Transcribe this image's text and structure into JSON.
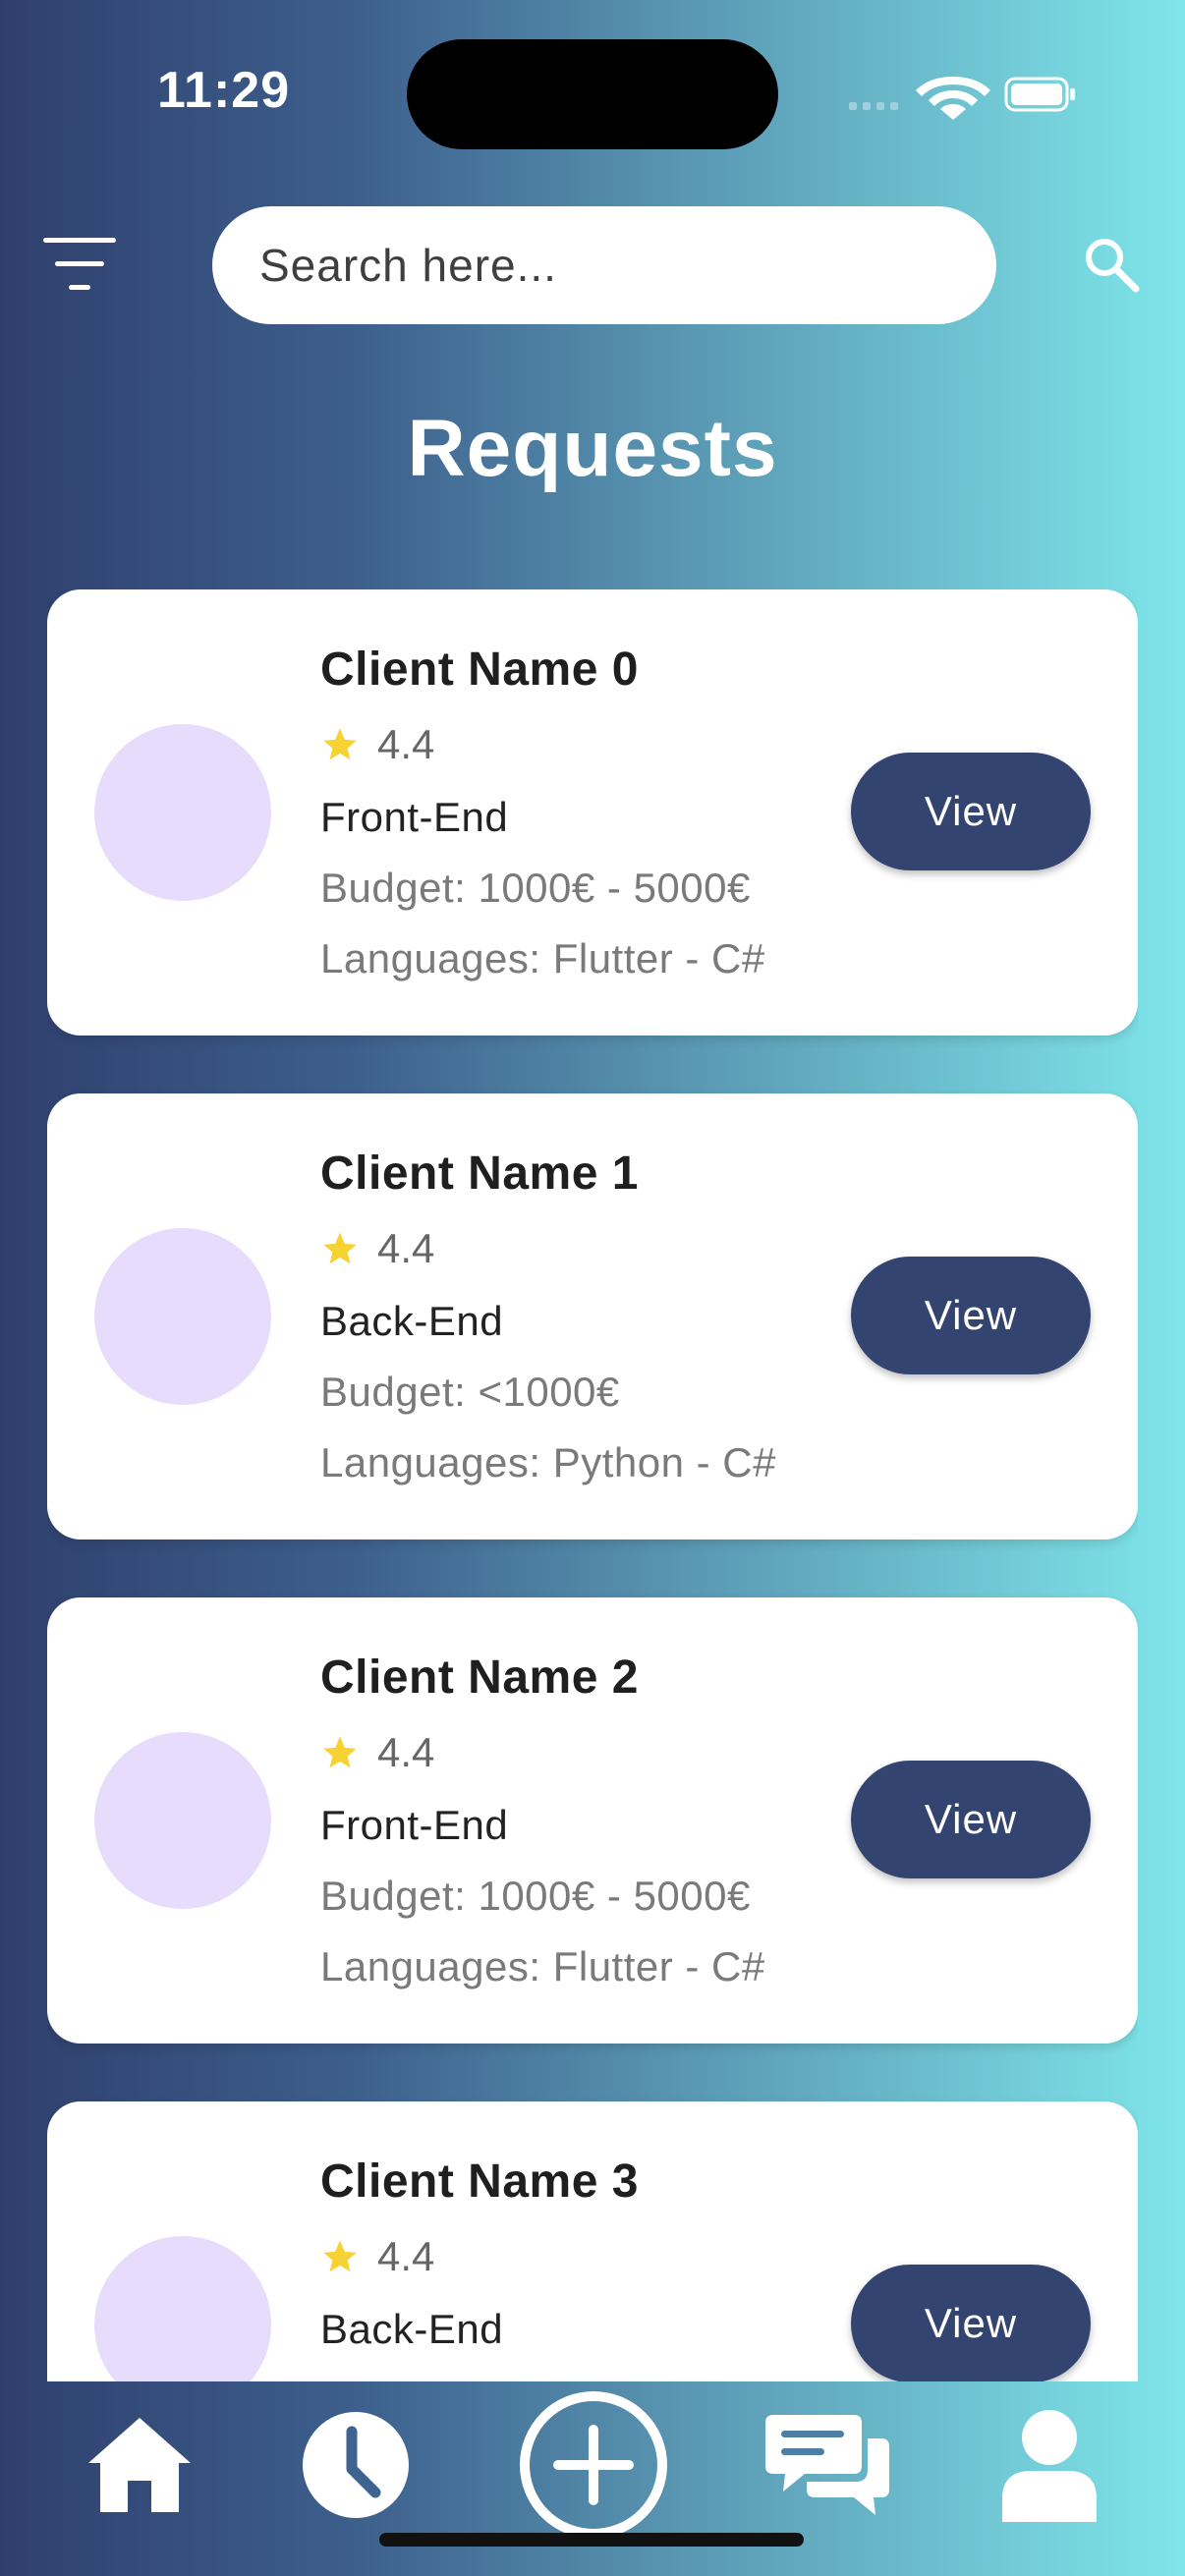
{
  "status_bar": {
    "time": "11:29"
  },
  "search": {
    "placeholder": "Search here..."
  },
  "page": {
    "title": "Requests"
  },
  "cards": [
    {
      "name": "Client Name 0",
      "rating": "4.4",
      "role": "Front-End",
      "budget": "Budget: 1000€ - 5000€",
      "languages": "Languages: Flutter - C#",
      "button": "View"
    },
    {
      "name": "Client Name 1",
      "rating": "4.4",
      "role": "Back-End",
      "budget": "Budget: <1000€",
      "languages": "Languages: Python - C#",
      "button": "View"
    },
    {
      "name": "Client Name 2",
      "rating": "4.4",
      "role": "Front-End",
      "budget": "Budget: 1000€ - 5000€",
      "languages": "Languages: Flutter - C#",
      "button": "View"
    },
    {
      "name": "Client Name 3",
      "rating": "4.4",
      "role": "Back-End",
      "button": "View"
    }
  ],
  "nav": {
    "items": [
      {
        "icon": "home-icon"
      },
      {
        "icon": "clock-icon"
      },
      {
        "icon": "add-circle-icon"
      },
      {
        "icon": "chat-icon"
      },
      {
        "icon": "profile-icon"
      }
    ]
  },
  "colors": {
    "accent": "#344470",
    "avatar": "#e8dcfd",
    "star": "#f6d232",
    "gradient_start": "#2f3f6d",
    "gradient_end": "#7fe6ea"
  }
}
